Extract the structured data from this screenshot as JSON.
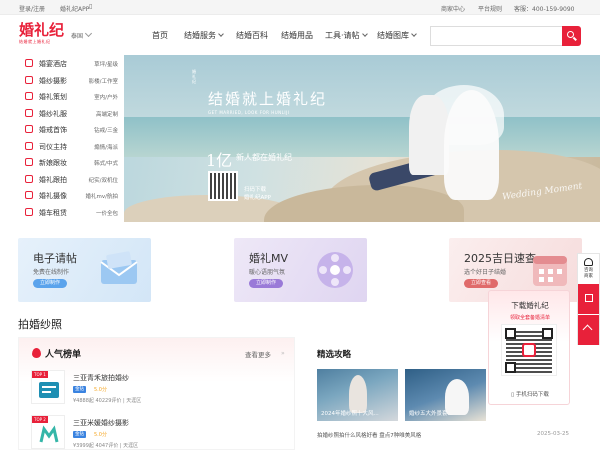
{
  "topbar": {
    "login": "登录/注册",
    "app": "婚礼纪APP",
    "merchant_center": "商家中心",
    "platform_rules": "平台规则",
    "service": "客服：400-159-9090"
  },
  "header": {
    "logo_text": "婚礼纪",
    "logo_sub": "结婚就上婚礼纪",
    "city": "泰国",
    "nav": [
      {
        "label": "首页"
      },
      {
        "label": "结婚服务",
        "dropdown": true
      },
      {
        "label": "结婚百科"
      },
      {
        "label": "结婚用品"
      },
      {
        "label": "工具·请帖",
        "dropdown": true
      },
      {
        "label": "结婚图库",
        "dropdown": true
      }
    ],
    "search_placeholder": ""
  },
  "categories": [
    {
      "label": "婚宴酒店",
      "sub": "草坪/星级",
      "icon": "hotel-icon"
    },
    {
      "label": "婚纱摄影",
      "sub": "影楼/工作室",
      "icon": "camera-icon"
    },
    {
      "label": "婚礼策划",
      "sub": "室内/户外",
      "icon": "planning-icon"
    },
    {
      "label": "婚纱礼服",
      "sub": "高端定制",
      "icon": "dress-icon"
    },
    {
      "label": "婚戒首饰",
      "sub": "钻戒/三金",
      "icon": "ring-icon"
    },
    {
      "label": "司仪主持",
      "sub": "煽情/海派",
      "icon": "mic-icon"
    },
    {
      "label": "新娘跟妆",
      "sub": "韩式/中式",
      "icon": "makeup-icon"
    },
    {
      "label": "婚礼跟拍",
      "sub": "纪实/双机位",
      "icon": "photo-icon"
    },
    {
      "label": "婚礼摄像",
      "sub": "婚礼mv/航拍",
      "icon": "video-icon"
    },
    {
      "label": "婚车租赁",
      "sub": "一价全包",
      "icon": "car-icon"
    }
  ],
  "hero": {
    "slogan": "结婚就上婚礼纪",
    "slogan_en": "GET MARRIED, LOOK FOR HUNLIJI",
    "users_num": "1亿",
    "users_text": "新人都在婚礼纪",
    "qr_text_1": "扫码下载",
    "qr_text_2": "婚礼纪APP",
    "script": "Wedding Moment",
    "vertical": "婚礼纪"
  },
  "features": [
    {
      "title": "电子请帖",
      "sub": "免费在线制作",
      "button": "立即制作",
      "color": "#5aa3ec"
    },
    {
      "title": "婚礼MV",
      "sub": "暖心语朋气氛",
      "button": "立即制作",
      "color": "#9a7ad8"
    },
    {
      "title": "2025吉日速查",
      "sub": "选个好日子结婚",
      "button": "立即查看",
      "color": "#e06b6b"
    }
  ],
  "section_title": "拍婚纱照",
  "ranking": {
    "title": "人气榜单",
    "more": "查看更多",
    "shops": [
      {
        "rank": "TOP 1",
        "name": "三亚青禾旅拍婚纱",
        "badge": "金钻",
        "stars": "5.0分",
        "meta": "¥4888起  40229评价  | 天涯区"
      },
      {
        "rank": "TOP 2",
        "name": "三亚米媛婚纱摄影",
        "badge": "金钻",
        "stars": "5.0分",
        "meta": "¥3999起  4047评价  | 天涯区"
      }
    ]
  },
  "strategy": {
    "title": "精选攻略",
    "items": [
      {
        "caption": "2024年婚纱照十大风..."
      },
      {
        "caption": "婚纱五大外景套..."
      }
    ],
    "article": "拍婚纱照拍什么风格好看 盘点7种唯美风格",
    "date": "2025-03-25"
  },
  "download": {
    "title": "下载婚礼纪",
    "sub": "领取全套备婚清单",
    "footer": "手机扫码下载"
  },
  "float_bar": {
    "consult": "咨询",
    "merchant": "商家"
  },
  "colors": {
    "brand": "#e8213a"
  }
}
